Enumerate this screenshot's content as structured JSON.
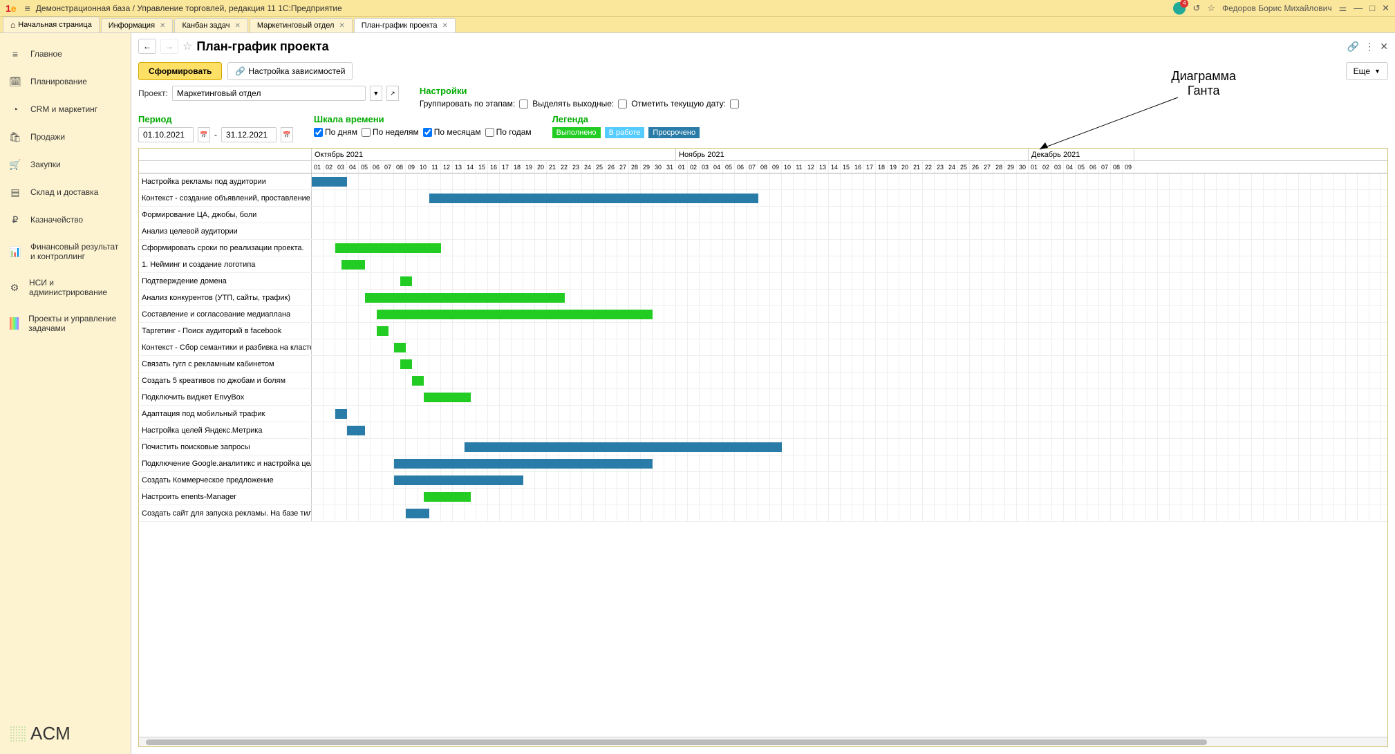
{
  "title_bar": {
    "app_title": "Демонстрационная база / Управление торговлей, редакция 11 1С:Предприятие",
    "user_name": "Федоров Борис Михайлович",
    "notif_count": "4"
  },
  "tabs": [
    {
      "label": "Начальная страница",
      "closable": false,
      "active": false,
      "home": true
    },
    {
      "label": "Информация",
      "closable": true,
      "active": false
    },
    {
      "label": "Канбан задач",
      "closable": true,
      "active": false
    },
    {
      "label": "Маркетинговый отдел",
      "closable": true,
      "active": false
    },
    {
      "label": "План-график проекта",
      "closable": true,
      "active": true
    }
  ],
  "sidebar": {
    "items": [
      {
        "icon": "≡",
        "label": "Главное"
      },
      {
        "icon": "🗓",
        "label": "Планирование"
      },
      {
        "icon": "◔",
        "label": "CRM и маркетинг"
      },
      {
        "icon": "🛍",
        "label": "Продажи"
      },
      {
        "icon": "🛒",
        "label": "Закупки"
      },
      {
        "icon": "▤",
        "label": "Склад и доставка"
      },
      {
        "icon": "₽",
        "label": "Казначейство"
      },
      {
        "icon": "📊",
        "label": "Финансовый результат и контроллинг"
      },
      {
        "icon": "⚙",
        "label": "НСИ и администрирование"
      },
      {
        "icon": "rainbow",
        "label": "Проекты и управление задачами"
      }
    ],
    "logo_text": "ACM"
  },
  "page": {
    "title": "План-график проекта",
    "btn_generate": "Сформировать",
    "btn_deps": "Настройка зависимостей",
    "btn_more": "Еще"
  },
  "filters": {
    "project_label": "Проект:",
    "project_value": "Маркетинговый отдел",
    "period_label": "Период",
    "date_from": "01.10.2021",
    "date_to": "31.12.2021",
    "scale_label": "Шкала времени",
    "scale_days": "По дням",
    "scale_weeks": "По неделям",
    "scale_months": "По месяцам",
    "scale_years": "По годам",
    "settings_label": "Настройки",
    "group_stages": "Группировать по этапам:",
    "highlight_weekends": "Выделять выходные:",
    "mark_today": "Отметить текущую дату:",
    "legend_label": "Легенда",
    "legend_done": "Выполнено",
    "legend_progress": "В работе",
    "legend_overdue": "Просрочено"
  },
  "annotation": {
    "line1": "Диаграмма",
    "line2": "Ганта"
  },
  "gantt": {
    "months": [
      {
        "name": "Октябрь 2021",
        "days": 31,
        "start_day": 1
      },
      {
        "name": "Ноябрь 2021",
        "days": 30,
        "start_day": 1
      },
      {
        "name": "Декабрь 2021",
        "days": 9,
        "start_day": 1
      }
    ],
    "day_width": 17,
    "tasks": [
      {
        "name": "Настройка рекламы под аудитории",
        "start": 0,
        "len": 3,
        "status": "overdue"
      },
      {
        "name": "Контекст - создание объявлений, проставление с...",
        "start": 10,
        "len": 28,
        "status": "overdue"
      },
      {
        "name": "Формирование ЦА, джобы, боли",
        "start": 0,
        "len": 0,
        "status": "none"
      },
      {
        "name": "Анализ целевой аудитории",
        "start": 0,
        "len": 0,
        "status": "none"
      },
      {
        "name": "Сформировать сроки по реализации проекта.",
        "start": 2,
        "len": 9,
        "status": "done"
      },
      {
        "name": "1. Нейминг и создание логотипа",
        "start": 2.5,
        "len": 2,
        "status": "done"
      },
      {
        "name": "Подтверждение домена",
        "start": 7.5,
        "len": 1,
        "status": "done"
      },
      {
        "name": "Анализ конкурентов (УТП, сайты, трафик)",
        "start": 4.5,
        "len": 17,
        "status": "done"
      },
      {
        "name": "Составление и согласование медиаплана",
        "start": 5.5,
        "len": 23.5,
        "status": "done"
      },
      {
        "name": "Таргетинг - Поиск аудиторий в facebook",
        "start": 5.5,
        "len": 1,
        "status": "done"
      },
      {
        "name": "Контекст - Сбор семантики и разбивка на кластеры",
        "start": 7,
        "len": 1,
        "status": "done"
      },
      {
        "name": "Связать гугл с рекламным кабинетом",
        "start": 7.5,
        "len": 1,
        "status": "done"
      },
      {
        "name": "Создать 5 креативов по джобам и болям",
        "start": 8.5,
        "len": 1,
        "status": "done"
      },
      {
        "name": "Подключить виджет EnvyBox",
        "start": 9.5,
        "len": 4,
        "status": "done"
      },
      {
        "name": "Адаптация под мобильный трафик",
        "start": 2,
        "len": 1,
        "status": "overdue"
      },
      {
        "name": "Настройка целей Яндекс.Метрика",
        "start": 3,
        "len": 1.5,
        "status": "overdue"
      },
      {
        "name": "Почистить поисковые запросы",
        "start": 13,
        "len": 27,
        "status": "overdue"
      },
      {
        "name": "Подключение Google.аналитикс и настройка целей",
        "start": 7,
        "len": 22,
        "status": "overdue"
      },
      {
        "name": "Создать Коммерческое предложение",
        "start": 7,
        "len": 11,
        "status": "overdue"
      },
      {
        "name": "Настроить enents-Manager",
        "start": 9.5,
        "len": 4,
        "status": "done"
      },
      {
        "name": "Создать сайт для запуска рекламы. На базе тильды",
        "start": 8,
        "len": 2,
        "status": "overdue"
      }
    ]
  }
}
